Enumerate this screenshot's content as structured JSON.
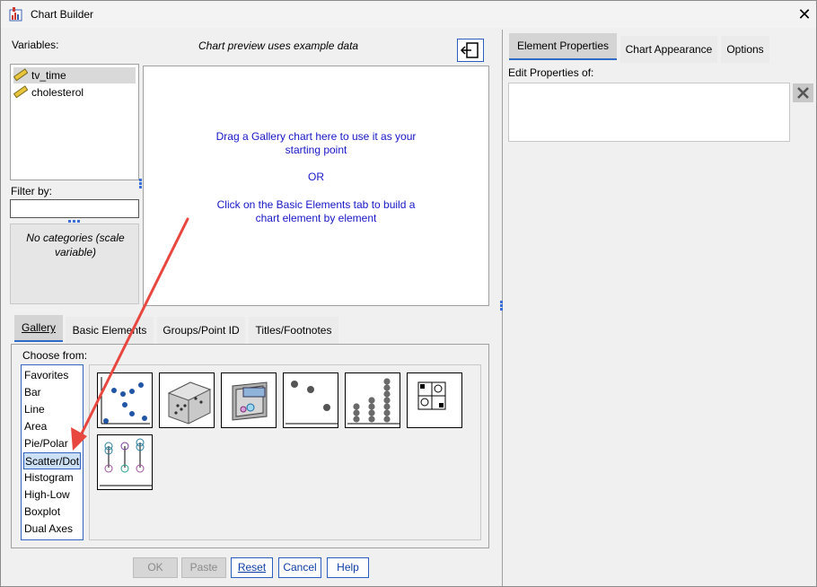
{
  "window": {
    "title": "Chart Builder"
  },
  "variables": {
    "label": "Variables:",
    "items": [
      {
        "name": "tv_time",
        "selected": true
      },
      {
        "name": "cholesterol",
        "selected": false
      }
    ]
  },
  "filter": {
    "label": "Filter by:",
    "value": ""
  },
  "categories_note": "No categories (scale variable)",
  "preview": {
    "caption": "Chart preview uses example data",
    "line1": "Drag a Gallery chart here to use it as your",
    "line2": "starting point",
    "line3": "OR",
    "line4": "Click on the Basic Elements tab to build a",
    "line5": "chart element by element"
  },
  "bottom_tabs": [
    "Gallery",
    "Basic Elements",
    "Groups/Point ID",
    "Titles/Footnotes"
  ],
  "gallery": {
    "choose_label": "Choose from:",
    "categories": [
      "Favorites",
      "Bar",
      "Line",
      "Area",
      "Pie/Polar",
      "Scatter/Dot",
      "Histogram",
      "High-Low",
      "Boxplot",
      "Dual Axes"
    ],
    "selected_category": "Scatter/Dot"
  },
  "right_tabs": [
    "Element Properties",
    "Chart Appearance",
    "Options"
  ],
  "edit_properties_label": "Edit Properties of:",
  "buttons": {
    "ok": "OK",
    "paste": "Paste",
    "reset": "Reset",
    "cancel": "Cancel",
    "help": "Help"
  },
  "colors": {
    "accent": "#2e6bc6",
    "link_text": "#1616c8",
    "arrow": "#e8473f"
  }
}
